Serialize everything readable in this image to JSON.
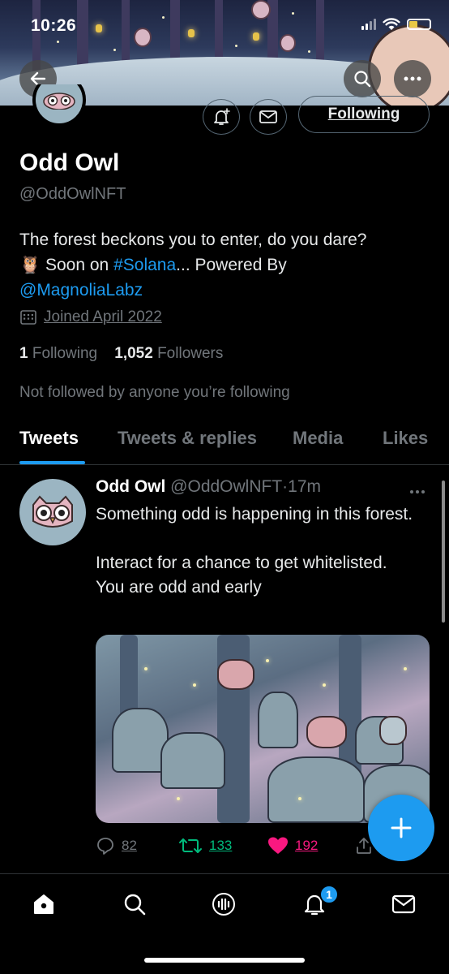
{
  "status_bar": {
    "time": "10:26"
  },
  "profile": {
    "name": "Odd Owl",
    "handle": "@OddOwlNFT",
    "following_button": "Following",
    "bio": {
      "line1": "The forest beckons you to enter, do you dare?",
      "emoji": "🦉",
      "soon_prefix": "Soon on ",
      "hashtag": "#Solana",
      "soon_suffix": "... Powered By",
      "mention": "@MagnoliaLabz"
    },
    "joined": "Joined April 2022",
    "following_count": "1",
    "following_label": "Following",
    "followers_count": "1,052",
    "followers_label": "Followers",
    "not_followed": "Not followed by anyone you’re following"
  },
  "tabs": [
    {
      "label": "Tweets",
      "active": true
    },
    {
      "label": "Tweets & replies",
      "active": false
    },
    {
      "label": "Media",
      "active": false
    },
    {
      "label": "Likes",
      "active": false
    }
  ],
  "tweet": {
    "author": "Odd Owl",
    "handle": "@OddOwlNFT",
    "separator": "·",
    "time": "17m",
    "text": "Something odd is happening in this forest.\n\nInteract for a chance to get whitelisted. You are odd and early",
    "replies": "82",
    "retweets": "133",
    "likes": "192"
  },
  "bottom_nav": {
    "items": [
      "home-icon",
      "search-icon",
      "spaces-icon",
      "notifications-icon",
      "messages-icon"
    ],
    "notification_badge": "1"
  },
  "colors": {
    "accent": "#1d9bf0",
    "retweet": "#00ba7c",
    "like": "#f91880",
    "muted": "#71767b"
  }
}
